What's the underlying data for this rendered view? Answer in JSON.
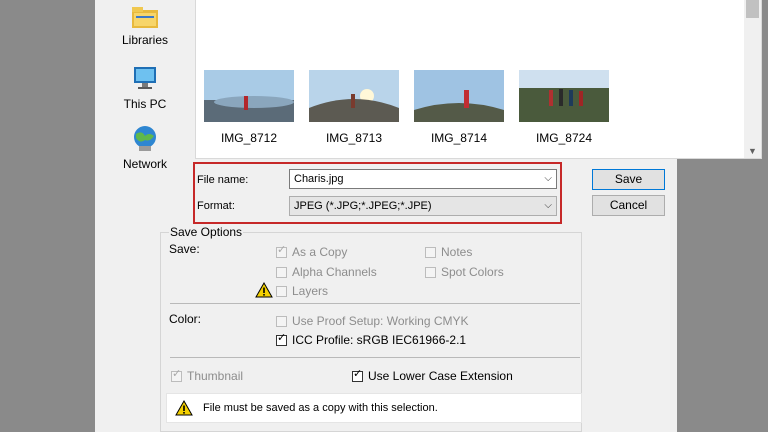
{
  "sidebar": {
    "items": [
      {
        "label": "Libraries",
        "icon": "libraries-icon"
      },
      {
        "label": "This PC",
        "icon": "this-pc-icon"
      },
      {
        "label": "Network",
        "icon": "network-icon"
      }
    ]
  },
  "files": [
    {
      "name": "IMG_8712"
    },
    {
      "name": "IMG_8713"
    },
    {
      "name": "IMG_8714"
    },
    {
      "name": "IMG_8724"
    }
  ],
  "form": {
    "file_name_label": "File name:",
    "file_name_value": "Charis.jpg",
    "format_label": "Format:",
    "format_value": "JPEG (*.JPG;*.JPEG;*.JPE)"
  },
  "buttons": {
    "save": "Save",
    "cancel": "Cancel"
  },
  "save_options": {
    "title": "Save Options",
    "save_label": "Save:",
    "as_a_copy": {
      "label": "As a Copy",
      "checked": true,
      "enabled": false
    },
    "notes": {
      "label": "Notes",
      "checked": false,
      "enabled": false
    },
    "alpha_channels": {
      "label": "Alpha Channels",
      "checked": false,
      "enabled": false
    },
    "spot_colors": {
      "label": "Spot Colors",
      "checked": false,
      "enabled": false
    },
    "layers": {
      "label": "Layers",
      "checked": false,
      "enabled": false
    },
    "color_label": "Color:",
    "use_proof_setup": {
      "label": "Use Proof Setup:  Working CMYK",
      "checked": false,
      "enabled": false
    },
    "icc_profile": {
      "label": "ICC Profile:  sRGB IEC61966-2.1",
      "checked": true,
      "enabled": true
    },
    "thumbnail": {
      "label": "Thumbnail",
      "checked": true,
      "enabled": false
    },
    "lower_case_ext": {
      "label": "Use Lower Case Extension",
      "checked": true,
      "enabled": true
    }
  },
  "warning": {
    "text": "File must be saved as a copy with this selection."
  },
  "colors": {
    "highlight": "#c62828",
    "accent": "#0078d7"
  }
}
